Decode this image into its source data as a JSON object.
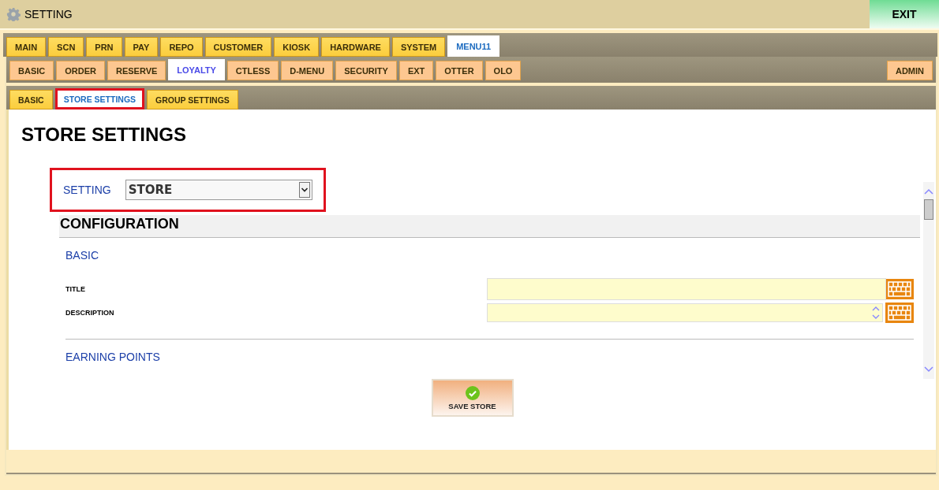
{
  "window": {
    "title": "SETTING",
    "exit_button": "EXIT"
  },
  "main_tabs": [
    {
      "label": "MAIN",
      "selected": false
    },
    {
      "label": "SCN",
      "selected": false
    },
    {
      "label": "PRN",
      "selected": false
    },
    {
      "label": "PAY",
      "selected": false
    },
    {
      "label": "REPO",
      "selected": false
    },
    {
      "label": "CUSTOMER",
      "selected": false
    },
    {
      "label": "KIOSK",
      "selected": false
    },
    {
      "label": "HARDWARE",
      "selected": false
    },
    {
      "label": "SYSTEM",
      "selected": false
    },
    {
      "label": "MENU11",
      "selected": true
    }
  ],
  "sub_tabs": [
    {
      "label": "BASIC",
      "selected": false
    },
    {
      "label": "ORDER",
      "selected": false
    },
    {
      "label": "RESERVE",
      "selected": false
    },
    {
      "label": "LOYALTY",
      "selected": true
    },
    {
      "label": "CTLESS",
      "selected": false
    },
    {
      "label": "D-MENU",
      "selected": false
    },
    {
      "label": "SECURITY",
      "selected": false
    },
    {
      "label": "EXT",
      "selected": false
    },
    {
      "label": "OTTER",
      "selected": false
    },
    {
      "label": "OLO",
      "selected": false
    }
  ],
  "admin_tab": {
    "label": "ADMIN",
    "selected": false
  },
  "section_tabs": [
    {
      "label": "BASIC",
      "selected": false,
      "highlighted": false
    },
    {
      "label": "STORE SETTINGS",
      "selected": true,
      "highlighted": true
    },
    {
      "label": "GROUP SETTINGS",
      "selected": false,
      "highlighted": false
    }
  ],
  "page_title": "STORE SETTINGS",
  "setting": {
    "label": "SETTING",
    "value": "STORE",
    "highlighted": true
  },
  "configuration": {
    "title": "CONFIGURATION",
    "groups": [
      {
        "title": "BASIC",
        "fields": [
          {
            "label": "TITLE",
            "kind": "text"
          },
          {
            "label": "DESCRIPTION",
            "kind": "textarea"
          }
        ]
      },
      {
        "title": "EARNING POINTS"
      }
    ]
  },
  "save_button": "SAVE STORE"
}
